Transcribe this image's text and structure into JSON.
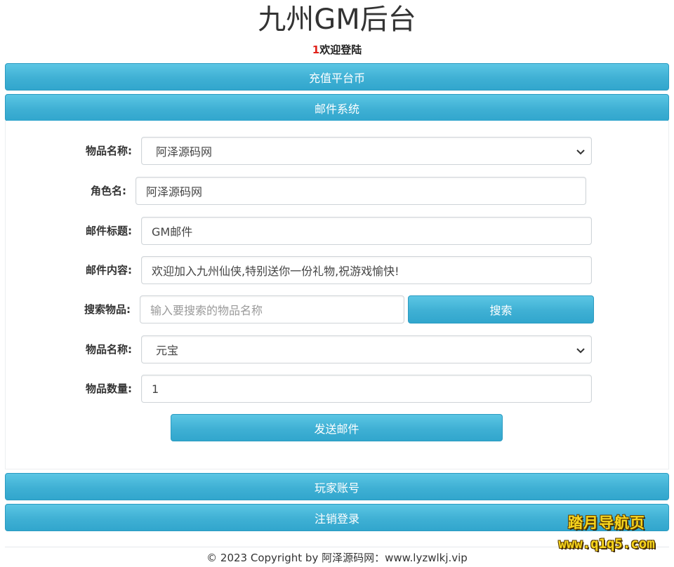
{
  "header": {
    "title": "九州GM后台",
    "welcome_uid": "1",
    "welcome_text": "欢迎登陆"
  },
  "nav": {
    "recharge": "充值平台币",
    "mail_system": "邮件系统",
    "player_account": "玩家账号",
    "logout": "注销登录"
  },
  "mail_form": {
    "item_select_label": "物品名称:",
    "item_select_value": "阿泽源码网",
    "role_label": "角色名:",
    "role_value": "阿泽源码网",
    "subject_label": "邮件标题:",
    "subject_value": "GM邮件",
    "content_label": "邮件内容:",
    "content_value": "欢迎加入九州仙侠,特别送你一份礼物,祝游戏愉快!",
    "search_label": "搜索物品:",
    "search_placeholder": "输入要搜索的物品名称",
    "search_button": "搜索",
    "item_name_label": "物品名称:",
    "item_name_value": "元宝",
    "quantity_label": "物品数量:",
    "quantity_value": "1",
    "send_button": "发送邮件"
  },
  "footer": {
    "copyright": "© 2023 Copyright by 阿泽源码网：www.lyzwlkj.vip"
  },
  "watermark": {
    "line1": "踏月导航页",
    "line2": "www.q1q5.com"
  },
  "colors": {
    "button_top": "#5bc6e4",
    "button_bottom": "#31a6cd",
    "uid_red": "#e0221b",
    "watermark_yellow": "#f7d51d"
  }
}
